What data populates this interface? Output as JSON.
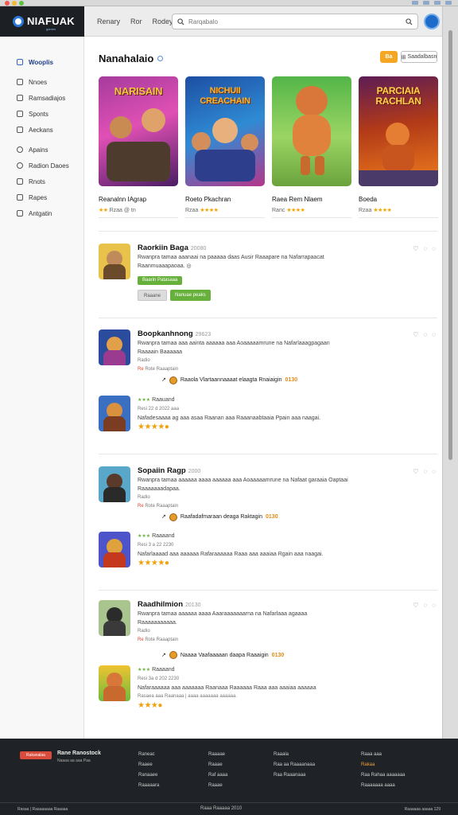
{
  "header": {
    "brand": "NIAFUAK",
    "brand_sub": "games",
    "nav": [
      "Renary",
      "Ror",
      "Rodey"
    ],
    "search_placeholder": "Rarqabalo"
  },
  "sidebar": {
    "items": [
      {
        "label": "Wooplis",
        "icon": "home-icon"
      },
      {
        "label": "Nnoes",
        "icon": "grid-icon"
      },
      {
        "label": "Ramsadiajos",
        "icon": "folder-icon"
      },
      {
        "label": "Sponts",
        "icon": "controller-icon"
      },
      {
        "label": "Aeckans",
        "icon": "list-icon"
      },
      {
        "label": "Apains",
        "icon": "shield-icon"
      },
      {
        "label": "Radion Daoes",
        "icon": "gear-icon"
      },
      {
        "label": "Rnots",
        "icon": "box-icon"
      },
      {
        "label": "Rapes",
        "icon": "chat-icon"
      },
      {
        "label": "Antgatin",
        "icon": "user-icon"
      }
    ]
  },
  "featured": {
    "title": "Nanahalaio",
    "pill": "Ba",
    "sort": "Saadalbasn",
    "cards": [
      {
        "art_title": "NARISAIN",
        "name": "Reanalnn IAgrap",
        "meta": "Rzaa @ tn",
        "colors": [
          "#8d2d86",
          "#e24ab0",
          "#4a1d64"
        ]
      },
      {
        "art_title": "NICHUII CREACHAIN",
        "name": "Roeto Pkachran",
        "meta": "Rzaa",
        "colors": [
          "#1d4ea4",
          "#2f8bd4",
          "#e0489e"
        ]
      },
      {
        "art_title": "",
        "name": "Raea Rem Nlaem",
        "meta": "Ranc",
        "colors": [
          "#47a83f",
          "#8ad15c",
          "#d9833c"
        ]
      },
      {
        "art_title": "PARCIAIA RACHLAN",
        "name": "Boeda",
        "meta": "Rzaa",
        "colors": [
          "#b23a18",
          "#f07f1d",
          "#5d1c55"
        ]
      }
    ]
  },
  "reviews": [
    {
      "title": "Raorkiin Baga",
      "date": "20080",
      "line1": "Rwanpra tamaa aaanaai na paaaaa daas Ausir Raaapare na Nafarrapaacat",
      "line2": "Raanmuaaapaoaa.",
      "button_green": "Baarin Patasaaa",
      "button_grey": "Raaane",
      "button_green2": "Nanuae peaks"
    },
    {
      "title": "Boopkanhnong",
      "date": "29623",
      "line1": "Rwanpra tamaa aaa aainta aaaaaa aaa Aoaaaaamrune na Nafarlaaagpagaan",
      "line2": "Raaaain Baaaaaa",
      "meta1": "Radio",
      "meta2": "Rote Raaaptain",
      "highlight": "Raaola Vlartaannaaaat elaagta Rnaiaigin",
      "highlight_score": "0130",
      "sub_rating": "Raauand",
      "sub_date": "Resi 22 d 2022 aaa",
      "sub_line": "Nafadesaaaa ag aaa asaa Raanan aaa Raaanaabtaaia Ppain aaa naagai."
    },
    {
      "title": "Sopaiin Ragp",
      "date": "2000",
      "line1": "Rwanpra tamaa aaaaaa aaaa aaaaaa aaa Aoaaaaamrune na Nafaat garaaia Oaptaai",
      "line2": "Raaaaaaadapaa.",
      "meta1": "Radio",
      "meta2": "Rote Raaaptain",
      "highlight": "Raafadafmaraan deaga Raktagin",
      "highlight_score": "0130",
      "sub_rating": "Raaaand",
      "sub_date": "Resi 3 a 22 2230",
      "sub_line": "Nafarlaaaad aaa aaaaaa Rafaraaaaaa Raaa aaa aaaiaa Rgain aaa naagai."
    },
    {
      "title": "Raadhilmion",
      "date": "20130",
      "line1": "Rwanpra tamaa aaaaaa aaaa Aaaraaaaaaarna na Nafarlaaa agaaaa",
      "line2": "Raaaaaaaaaaa.",
      "meta1": "Radio",
      "meta2": "Rote Raaaptain",
      "highlight": "Naaaa Vaafaaaaan daapa Raaaigin",
      "highlight_score": "0130",
      "sub_rating": "Raaaand",
      "sub_date": "Resi 3a d 202 2230",
      "sub_line": "Nafaraaaaaa aaa aaaaaaa Raanaaa Raaaaaa Raaa aaa aaaiaa aaaaaa",
      "sub_line2": "Rasaea aaa Raanaaa  |  aaaa aaaaaaa aaaaaa."
    }
  ],
  "footer": {
    "logo": "Rakanalaa",
    "brand": "Rane Ranostock",
    "tagline": "Naaaa aa aaa Paa",
    "cols": [
      [
        "Raneac",
        "Raaee",
        "Ranaaee",
        "Raaaaara"
      ],
      [
        "Raaaae",
        "Raaae",
        "Raf aaaa",
        "Raaae"
      ],
      [
        "Raaaia",
        "Raa aa Raaaanaaa",
        "Raa Raaanaaa",
        ""
      ],
      [
        "Raaa aaa",
        "Rakaa",
        "Raa Rahaa aaaaaaa",
        "Raaaaaaa aaaa"
      ]
    ],
    "bottom_left": "Rasaa  |  Raaaaaaaa Raaaaa",
    "bottom_center": "Raaa Raaaaa 2010",
    "bottom_right": "Raaaaaa aaaaa  129"
  }
}
